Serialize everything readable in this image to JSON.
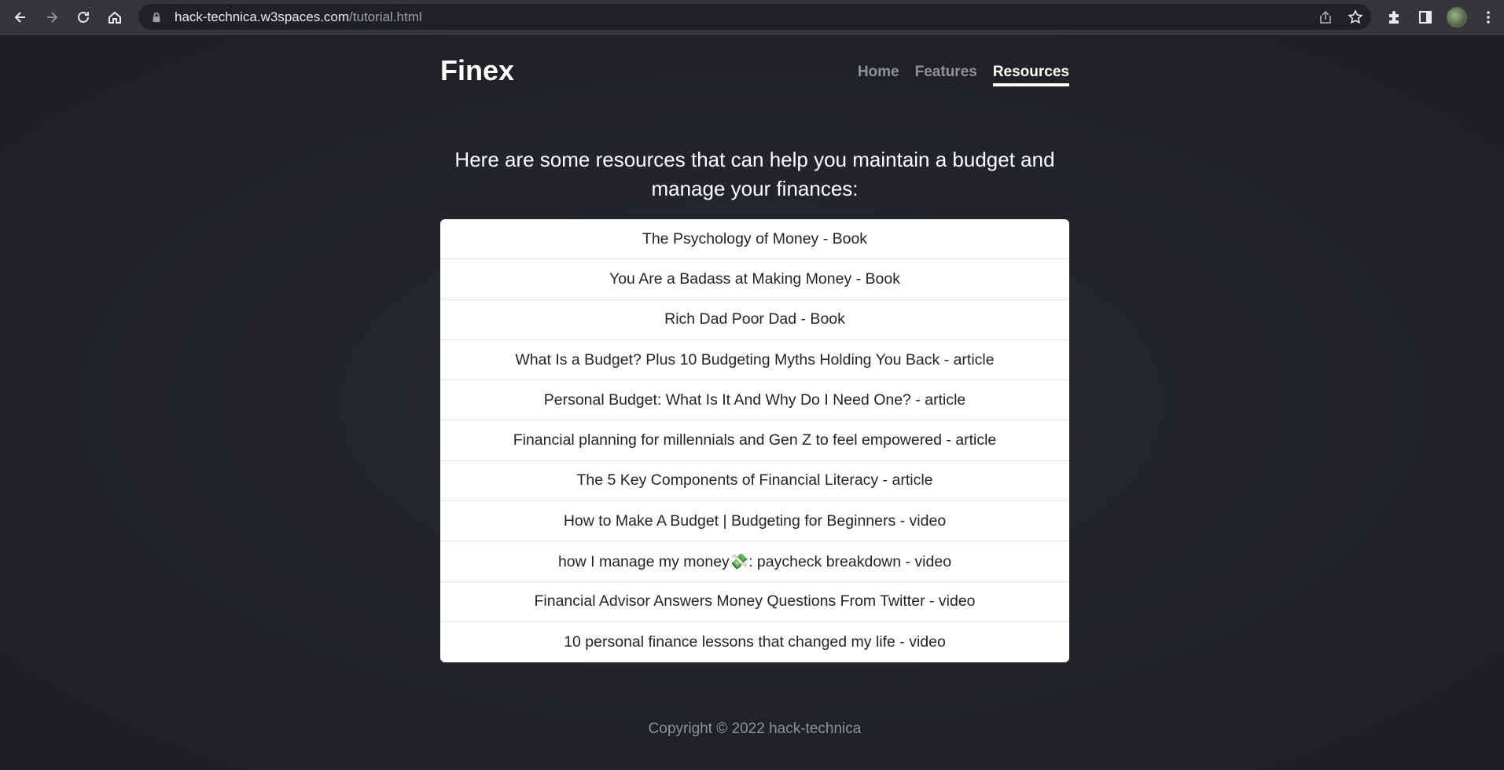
{
  "browser": {
    "url_host": "hack-technica.w3spaces.com",
    "url_path": "/tutorial.html"
  },
  "site": {
    "brand": "Finex",
    "nav": [
      {
        "label": "Home",
        "active": false
      },
      {
        "label": "Features",
        "active": false
      },
      {
        "label": "Resources",
        "active": true
      }
    ]
  },
  "main": {
    "lead": "Here are some resources that can help you maintain a budget and manage your finances:",
    "resources": [
      "The Psychology of Money - Book",
      "You Are a Badass at Making Money - Book",
      "Rich Dad Poor Dad - Book",
      "What Is a Budget? Plus 10 Budgeting Myths Holding You Back - article",
      "Personal Budget: What Is It And Why Do I Need One? - article",
      "Financial planning for millennials and Gen Z to feel empowered - article",
      "The 5 Key Components of Financial Literacy - article",
      "How to Make A Budget | Budgeting for Beginners - video",
      "how I manage my money💸: paycheck breakdown - video",
      "Financial Advisor Answers Money Questions From Twitter - video",
      "10 personal finance lessons that changed my life - video"
    ]
  },
  "footer": {
    "copyright": "Copyright © 2022 hack-technica"
  }
}
